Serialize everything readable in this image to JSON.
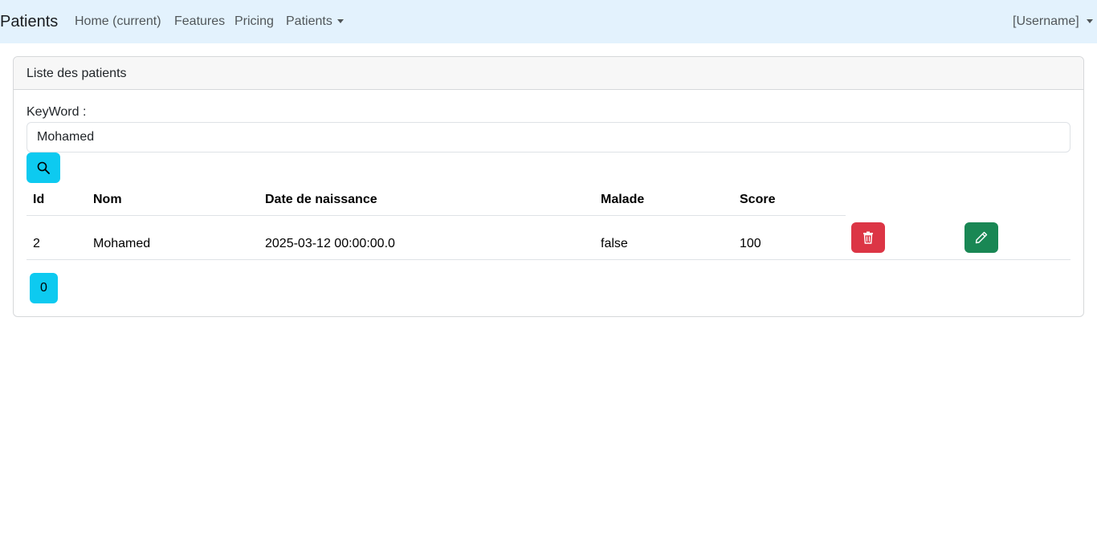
{
  "navbar": {
    "brand": "Patients",
    "links": [
      {
        "label": "Home (current)"
      },
      {
        "label": "Features"
      },
      {
        "label": "Pricing"
      },
      {
        "label": "Patients"
      }
    ],
    "user_label": "[Username]"
  },
  "card": {
    "header": "Liste des patients"
  },
  "search": {
    "label": "KeyWord :",
    "value": "Mohamed",
    "button_icon": "search-icon"
  },
  "table": {
    "columns": [
      "Id",
      "Nom",
      "Date de naissance",
      "Malade",
      "Score"
    ],
    "rows": [
      {
        "id": "2",
        "nom": "Mohamed",
        "date": "2025-03-12 00:00:00.0",
        "malade": "false",
        "score": "100",
        "delete_icon": "trash-icon",
        "edit_icon": "pencil-icon"
      }
    ]
  },
  "pagination": {
    "pages": [
      "0"
    ]
  },
  "colors": {
    "navbar_bg": "#e3f2fd",
    "info": "#0dcaf0",
    "danger": "#dc3545",
    "success": "#198754"
  }
}
